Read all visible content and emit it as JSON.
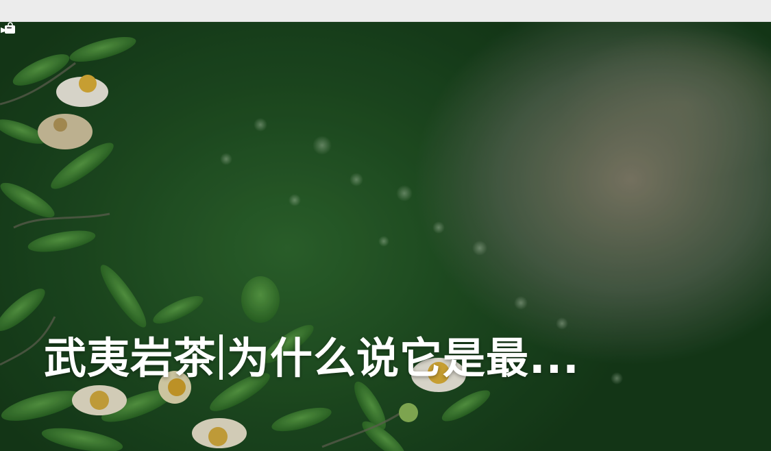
{
  "hero": {
    "title_part1": "武夷岩茶",
    "title_part2": "为什么说它是最...",
    "video_icon": "video-camera-icon",
    "image_subject": "tea-bush-blossoms"
  },
  "colors": {
    "title_text": "#ffffff",
    "top_bar": "#ececec",
    "foliage_dark": "#163d1a",
    "foliage_mid": "#2f6a2f",
    "blossom_white": "#f4f1e4",
    "blossom_yellow": "#e2b43a"
  }
}
